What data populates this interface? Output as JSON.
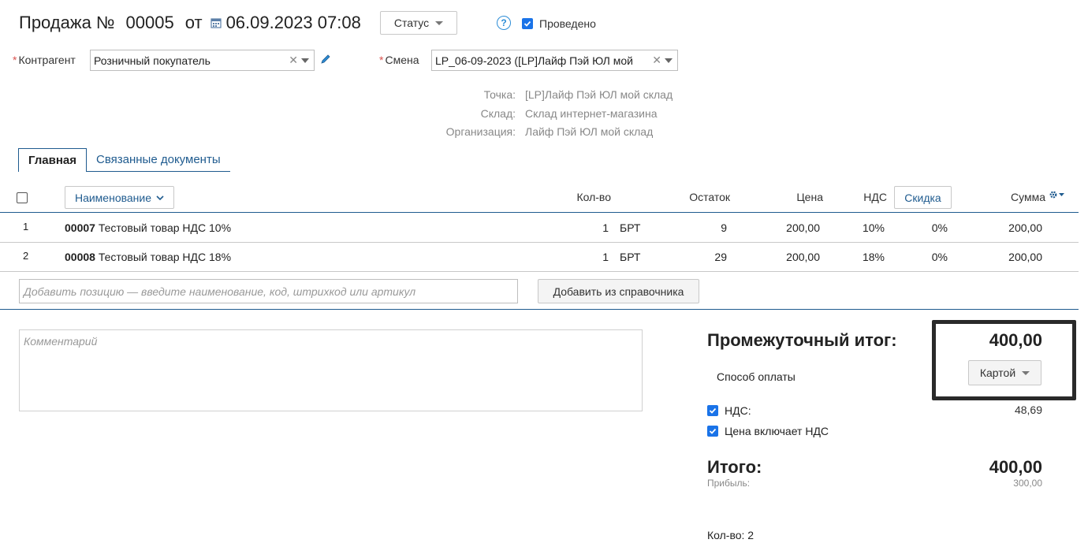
{
  "header": {
    "title_prefix": "Продажа №",
    "number": "00005",
    "from_label": "от",
    "datetime": "06.09.2023 07:08",
    "status_button": "Статус",
    "help_label": "?",
    "posted_label": "Проведено"
  },
  "fields": {
    "counterparty_label": "Контрагент",
    "counterparty_value": "Розничный покупатель",
    "shift_label": "Смена",
    "shift_value": "LP_06-09-2023 ([LP]Лайф Пэй ЮЛ мой",
    "required_mark": "*"
  },
  "info": {
    "point_label": "Точка:",
    "point_value": "[LP]Лайф Пэй ЮЛ мой склад",
    "warehouse_label": "Склад:",
    "warehouse_value": "Склад интернет-магазина",
    "org_label": "Организация:",
    "org_value": "Лайф Пэй ЮЛ мой склад"
  },
  "tabs": [
    {
      "label": "Главная"
    },
    {
      "label": "Связанные документы"
    }
  ],
  "table": {
    "headers": {
      "name": "Наименование",
      "qty": "Кол-во",
      "stock": "Остаток",
      "price": "Цена",
      "vat": "НДС",
      "discount": "Скидка",
      "sum": "Сумма"
    },
    "rows": [
      {
        "index": "1",
        "code": "00007",
        "name": "Тестовый товар НДС 10%",
        "qty": "1",
        "unit": "БРТ",
        "stock": "9",
        "price": "200,00",
        "vat": "10%",
        "discount": "0%",
        "sum": "200,00"
      },
      {
        "index": "2",
        "code": "00008",
        "name": "Тестовый товар НДС 18%",
        "qty": "1",
        "unit": "БРТ",
        "stock": "29",
        "price": "200,00",
        "vat": "18%",
        "discount": "0%",
        "sum": "200,00"
      }
    ]
  },
  "add": {
    "placeholder": "Добавить позицию — введите наименование, код, штрихкод или артикул",
    "from_catalog_button": "Добавить из справочника"
  },
  "comment": {
    "placeholder": "Комментарий"
  },
  "totals": {
    "subtotal_label": "Промежуточный итог:",
    "subtotal_value": "400,00",
    "payment_label": "Способ оплаты",
    "payment_value": "Картой",
    "vat_label": "НДС:",
    "vat_value": "48,69",
    "price_incl_vat_label": "Цена включает НДС",
    "total_label": "Итого:",
    "total_value": "400,00",
    "profit_label": "Прибыль:",
    "profit_value": "300,00",
    "qty_label": "Кол-во: 2"
  },
  "colors": {
    "accent": "#1f5b8f",
    "checkbox": "#1a73e8",
    "required": "#d9534f"
  }
}
